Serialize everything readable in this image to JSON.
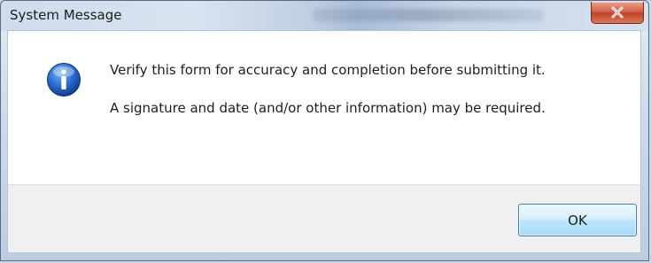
{
  "dialog": {
    "title": "System Message",
    "message_line1": "Verify this form for accuracy and completion before submitting it.",
    "message_line2": "A signature and date (and/or other information) may be required.",
    "ok_label": "OK",
    "close_icon": "close-icon",
    "info_icon": "info-icon"
  },
  "colors": {
    "close_button": "#c7472d",
    "info_icon": "#1f5fb8",
    "ok_border": "#3c7fb1"
  }
}
